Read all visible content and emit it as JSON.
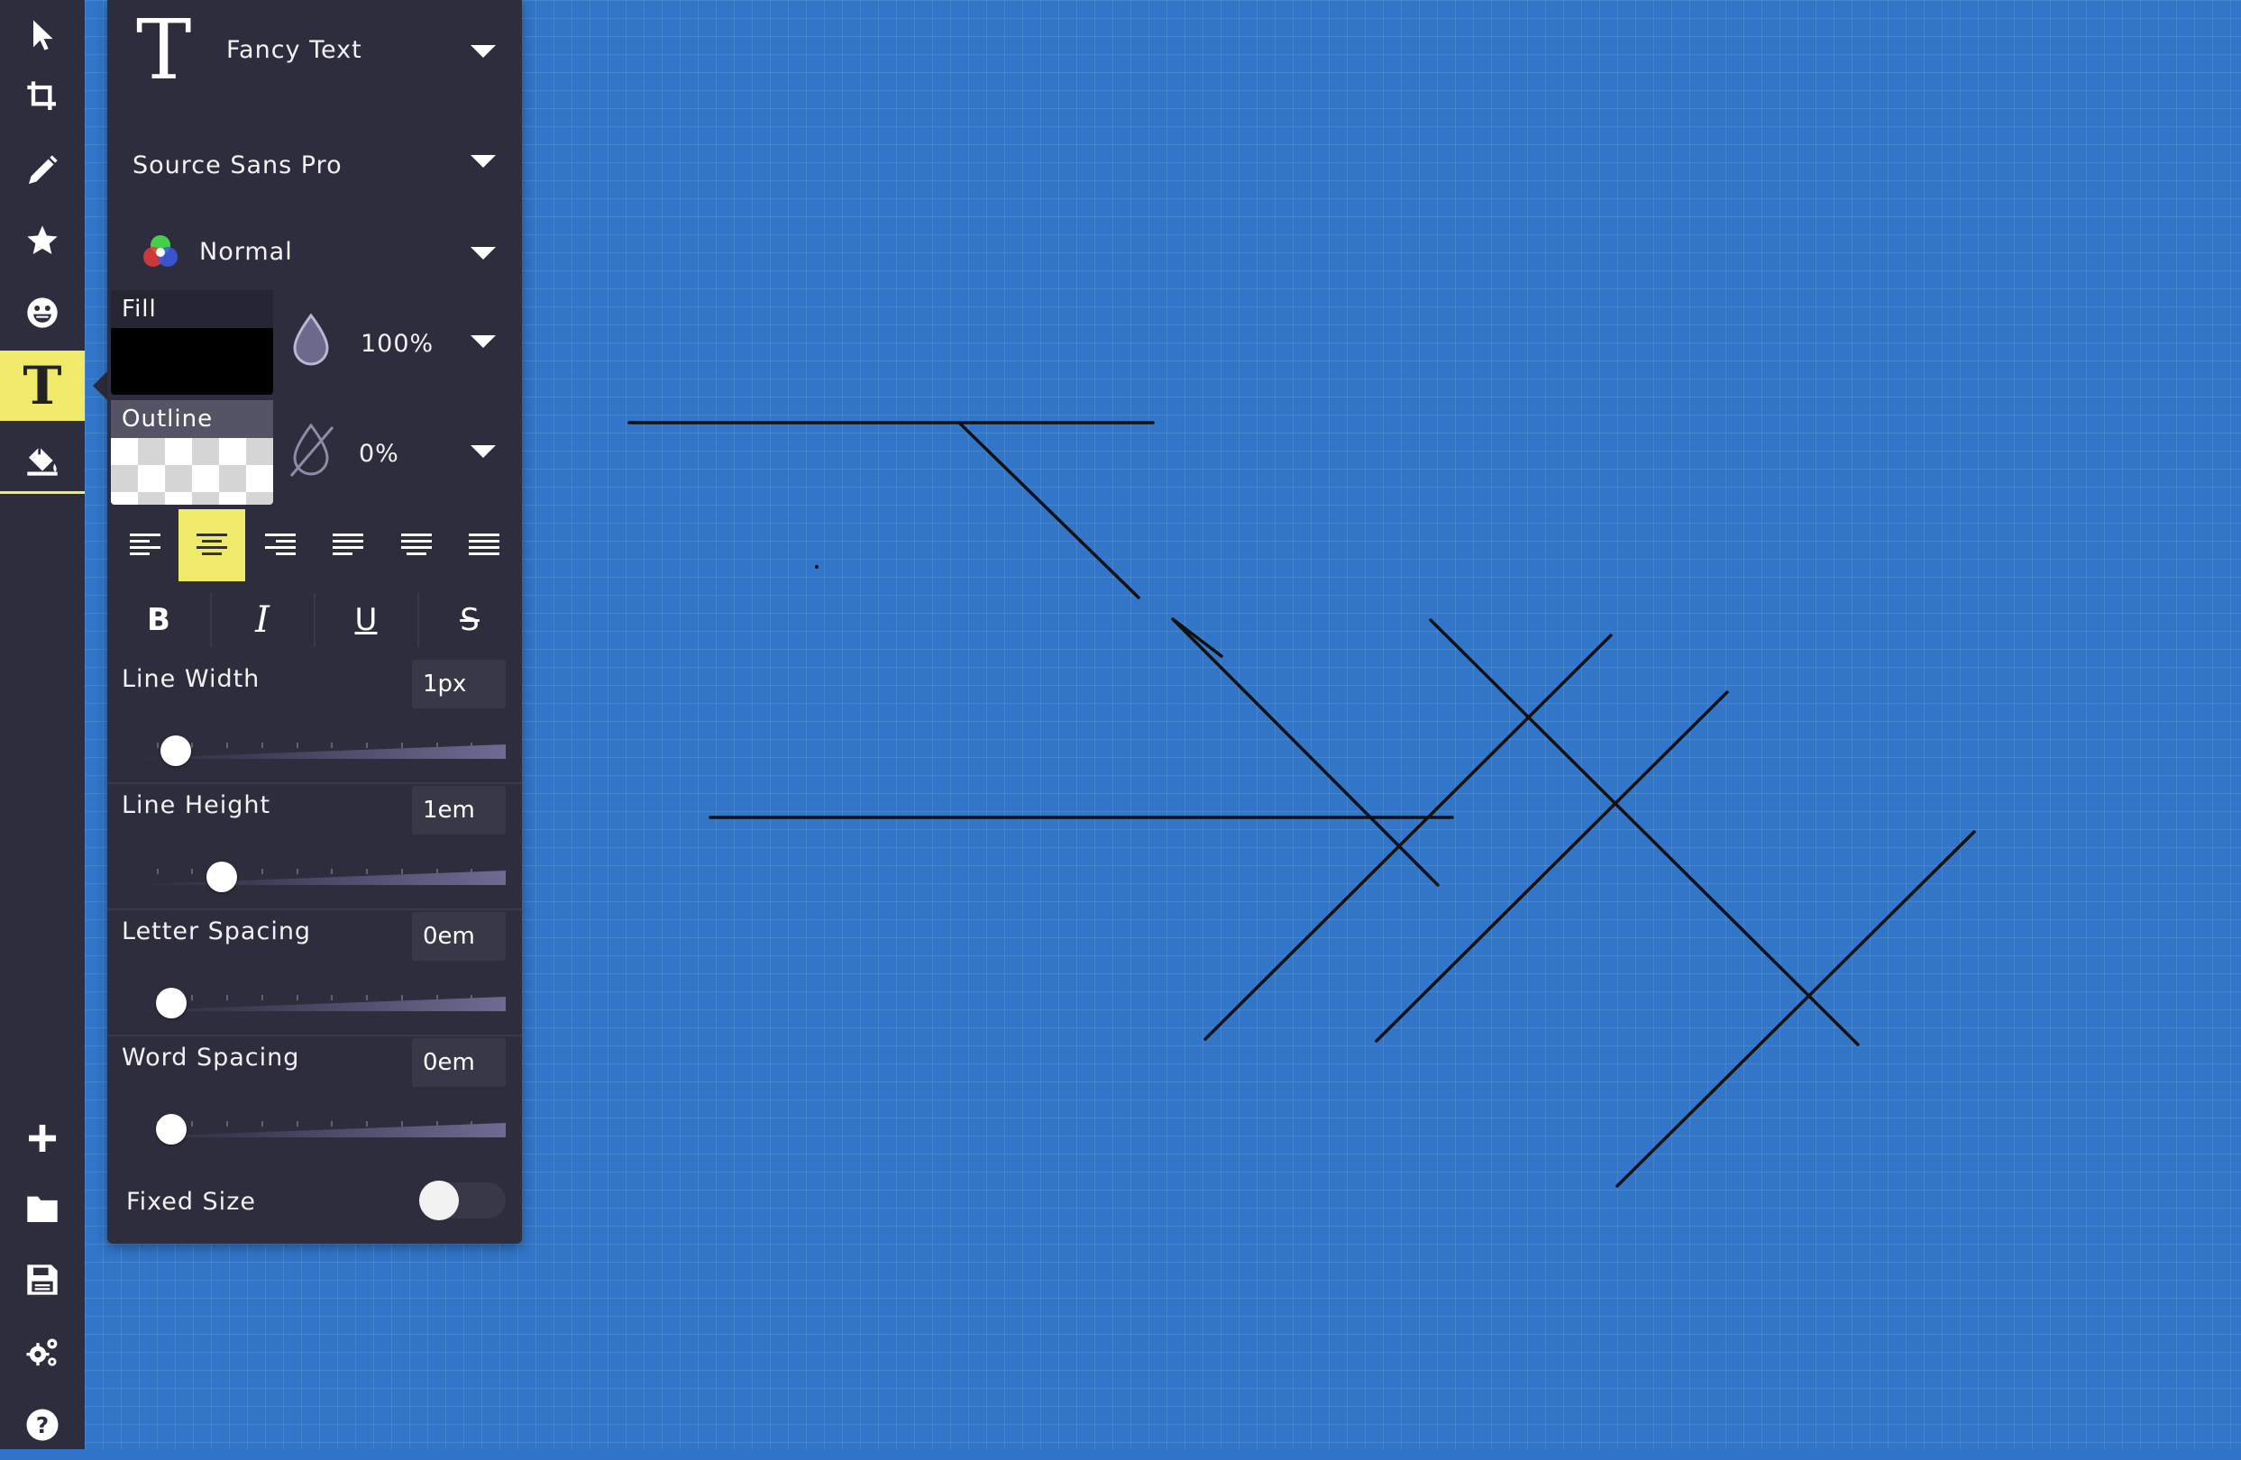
{
  "toolbar": {
    "tools": [
      {
        "name": "select-tool",
        "icon": "cursor-arrow-icon"
      },
      {
        "name": "crop-tool",
        "icon": "crop-icon"
      },
      {
        "name": "draw-tool",
        "icon": "pencil-icon"
      },
      {
        "name": "shapes-tool",
        "icon": "star-icon"
      },
      {
        "name": "stickers-tool",
        "icon": "smiley-icon"
      },
      {
        "name": "text-tool",
        "icon": "text-t-icon",
        "glyph": "T",
        "active": true
      },
      {
        "name": "fill-tool",
        "icon": "paint-bucket-icon"
      }
    ],
    "bottom": [
      {
        "name": "new-button",
        "icon": "plus-icon"
      },
      {
        "name": "open-button",
        "icon": "folder-icon"
      },
      {
        "name": "save-button",
        "icon": "save-disk-icon"
      },
      {
        "name": "settings-button",
        "icon": "gears-icon"
      },
      {
        "name": "help-button",
        "icon": "question-circle-icon",
        "glyph": "?"
      }
    ],
    "active_color": "#f0ea6a"
  },
  "text_panel": {
    "style_glyph": "T",
    "style_name": "Fancy Text",
    "font": "Source Sans Pro",
    "blend_mode": "Normal",
    "fill": {
      "label": "Fill",
      "color": "#000000",
      "opacity": "100%"
    },
    "outline": {
      "label": "Outline",
      "opacity": "0%"
    },
    "alignment": {
      "options": [
        "left",
        "center",
        "right",
        "justify-left",
        "justify-center",
        "justify-all"
      ],
      "selected": "center"
    },
    "styles": {
      "bold": "B",
      "italic": "I",
      "underline": "U",
      "strike": "S"
    },
    "line_width": {
      "label": "Line Width",
      "value": "1px",
      "level": 0.14
    },
    "line_height": {
      "label": "Line Height",
      "value": "1em",
      "level": 0.26
    },
    "letter_spacing": {
      "label": "Letter Spacing",
      "value": "0em",
      "level": 0.13
    },
    "word_spacing": {
      "label": "Word Spacing",
      "value": "0em",
      "level": 0.13
    },
    "fixed_size": {
      "label": "Fixed Size",
      "enabled": false
    }
  },
  "canvas": {
    "background": "#3176c9",
    "stroke_color": "#111111"
  }
}
